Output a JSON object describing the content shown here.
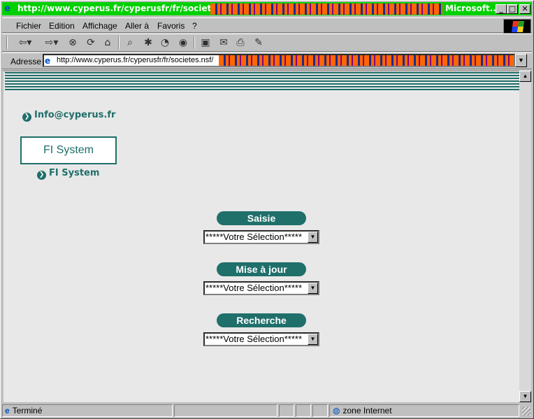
{
  "window": {
    "title_url": "http://www.cyperus.fr/cyperusfr/fr/societes.nsf/",
    "app_name": "Microsoft...",
    "controls": {
      "minimize": "_",
      "maximize": "□",
      "close": "✕"
    }
  },
  "menu": {
    "items": [
      "Fichier",
      "Edition",
      "Affichage",
      "Aller à",
      "Favoris",
      "?"
    ]
  },
  "toolbar": {
    "icons": [
      "back-icon",
      "forward-icon",
      "stop-icon",
      "refresh-icon",
      "home-icon",
      "search-icon",
      "favorites-icon",
      "history-icon",
      "channels-icon",
      "fullscreen-icon",
      "mail-icon",
      "print-icon",
      "edit-icon"
    ]
  },
  "address": {
    "label": "Adresse",
    "url": "http://www.cyperus.fr/cyperusfr/fr/societes.nsf/"
  },
  "page": {
    "email_link": "Info@cyperus.fr",
    "company_box": "FI System",
    "company_link": "FI System",
    "sections": [
      {
        "label": "Saisie",
        "select_value": "*****Votre Sélection*****"
      },
      {
        "label": "Mise à jour",
        "select_value": "*****Votre Sélection*****"
      },
      {
        "label": "Recherche",
        "select_value": "*****Votre Sélection*****"
      }
    ]
  },
  "status": {
    "text": "Terminé",
    "zone": "zone Internet"
  },
  "colors": {
    "title_bar": "#00d000",
    "accent": "#1f6f6a",
    "banner_pattern": "#ff6600"
  }
}
